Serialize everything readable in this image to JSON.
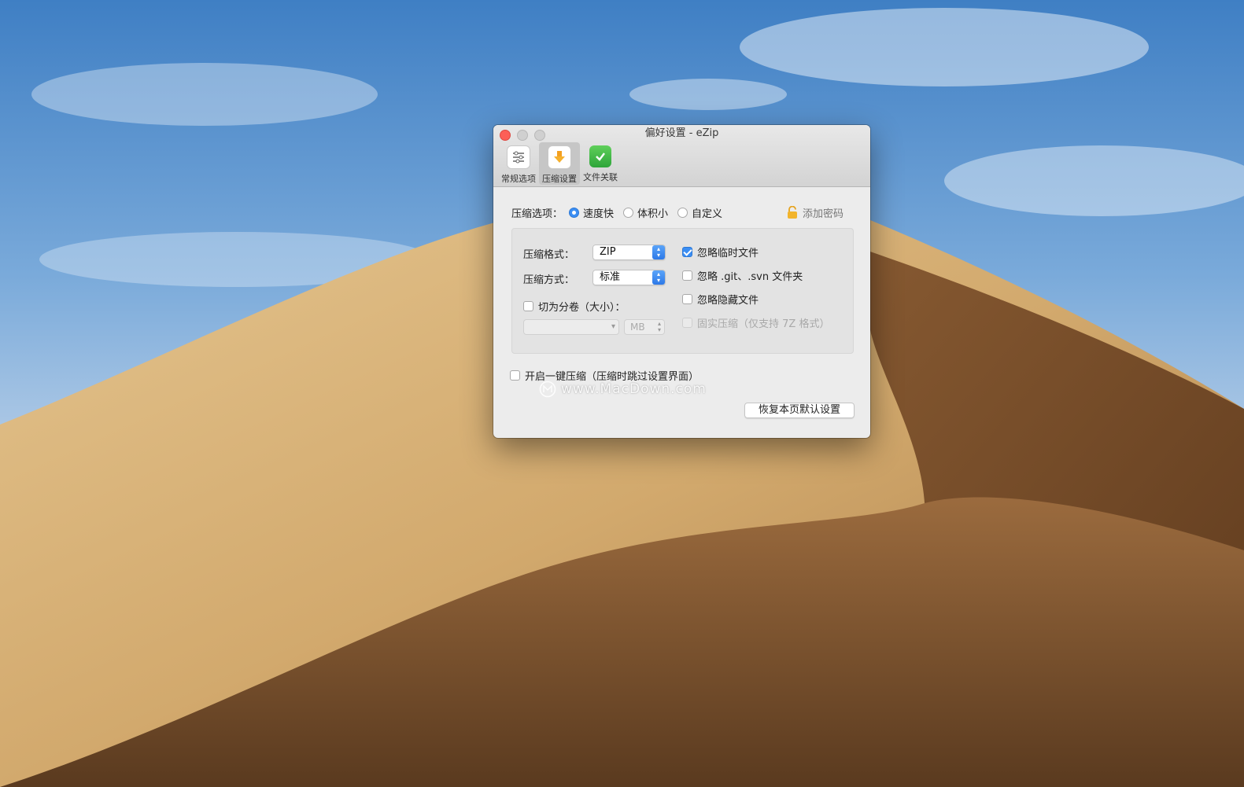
{
  "window": {
    "title": "偏好设置 - eZip"
  },
  "toolbar": {
    "items": [
      {
        "label": "常规选项",
        "icon": "sliders-icon",
        "active": false
      },
      {
        "label": "压缩设置",
        "icon": "compress-arrow-icon",
        "active": true
      },
      {
        "label": "文件关联",
        "icon": "checkmark-file-icon",
        "active": false
      }
    ]
  },
  "compress_options": {
    "label": "压缩选项：",
    "choices": [
      "速度快",
      "体积小",
      "自定义"
    ],
    "selected": "速度快",
    "password_label": "添加密码"
  },
  "format": {
    "label": "压缩格式：",
    "value": "ZIP"
  },
  "method": {
    "label": "压缩方式：",
    "value": "标准"
  },
  "split": {
    "label": "切为分卷（大小）：",
    "checked": false,
    "size_value": "",
    "unit": "MB"
  },
  "ignore": {
    "temp_files": {
      "label": "忽略临时文件",
      "checked": true
    },
    "vcs_folders": {
      "label": "忽略 .git、.svn 文件夹",
      "checked": false
    },
    "hidden_files": {
      "label": "忽略隐藏文件",
      "checked": false
    },
    "solid": {
      "label": "固实压缩（仅支持 7Z 格式）",
      "checked": false,
      "disabled": true
    }
  },
  "one_key": {
    "label": "开启一键压缩（压缩时跳过设置界面）",
    "checked": false
  },
  "watermark": "www.MacDown.com",
  "reset_button": "恢复本页默认设置",
  "colors": {
    "accent": "#3b8ef3",
    "close": "#fc5f57",
    "window_bg": "#ececec"
  }
}
